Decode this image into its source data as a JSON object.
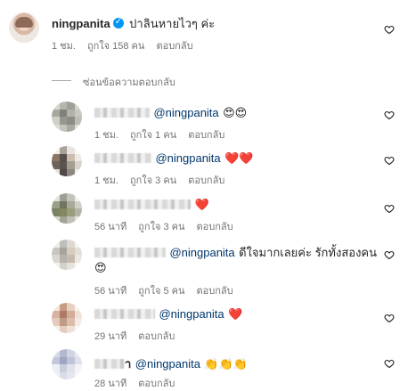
{
  "main_comment": {
    "username": "ningpanita",
    "text": "ปาลินหายไวๆ ค่ะ",
    "time": "1 ชม.",
    "likes": "ถูกใจ 158 คน",
    "reply": "ตอบกลับ"
  },
  "hide_replies": "ซ่อนข้อความตอบกลับ",
  "replies": [
    {
      "mention": "@ningpanita",
      "emoji": "😍😍",
      "time": "1 ชม.",
      "likes": "ถูกใจ 1 คน",
      "reply": "ตอบกลับ"
    },
    {
      "mention": "@ningpanita",
      "emoji": "❤️❤️",
      "time": "1 ชม.",
      "likes": "ถูกใจ 3 คน",
      "reply": "ตอบกลับ"
    },
    {
      "mention": "",
      "emoji": "❤️",
      "time": "56 นาที",
      "likes": "ถูกใจ 3 คน",
      "reply": "ตอบกลับ"
    },
    {
      "mention": "@ningpanita",
      "text": "ดีใจมากเลยค่ะ รักทั้งสองคน",
      "emoji": "😍",
      "time": "56 นาที",
      "likes": "ถูกใจ 5 คน",
      "reply": "ตอบกลับ"
    },
    {
      "mention": "@ningpanita",
      "emoji": "❤️",
      "time": "29 นาที",
      "reply": "ตอบกลับ"
    },
    {
      "suffix": "า",
      "mention": "@ningpanita",
      "emoji": "👏👏👏",
      "time": "28 นาที",
      "reply": "ตอบกลับ"
    }
  ],
  "icons": {
    "like": "heart-outline-icon",
    "verified": "verified-badge-icon"
  },
  "colors": {
    "text": "#262626",
    "meta": "#737373",
    "mention": "#00376b",
    "verified": "#0095f6"
  }
}
